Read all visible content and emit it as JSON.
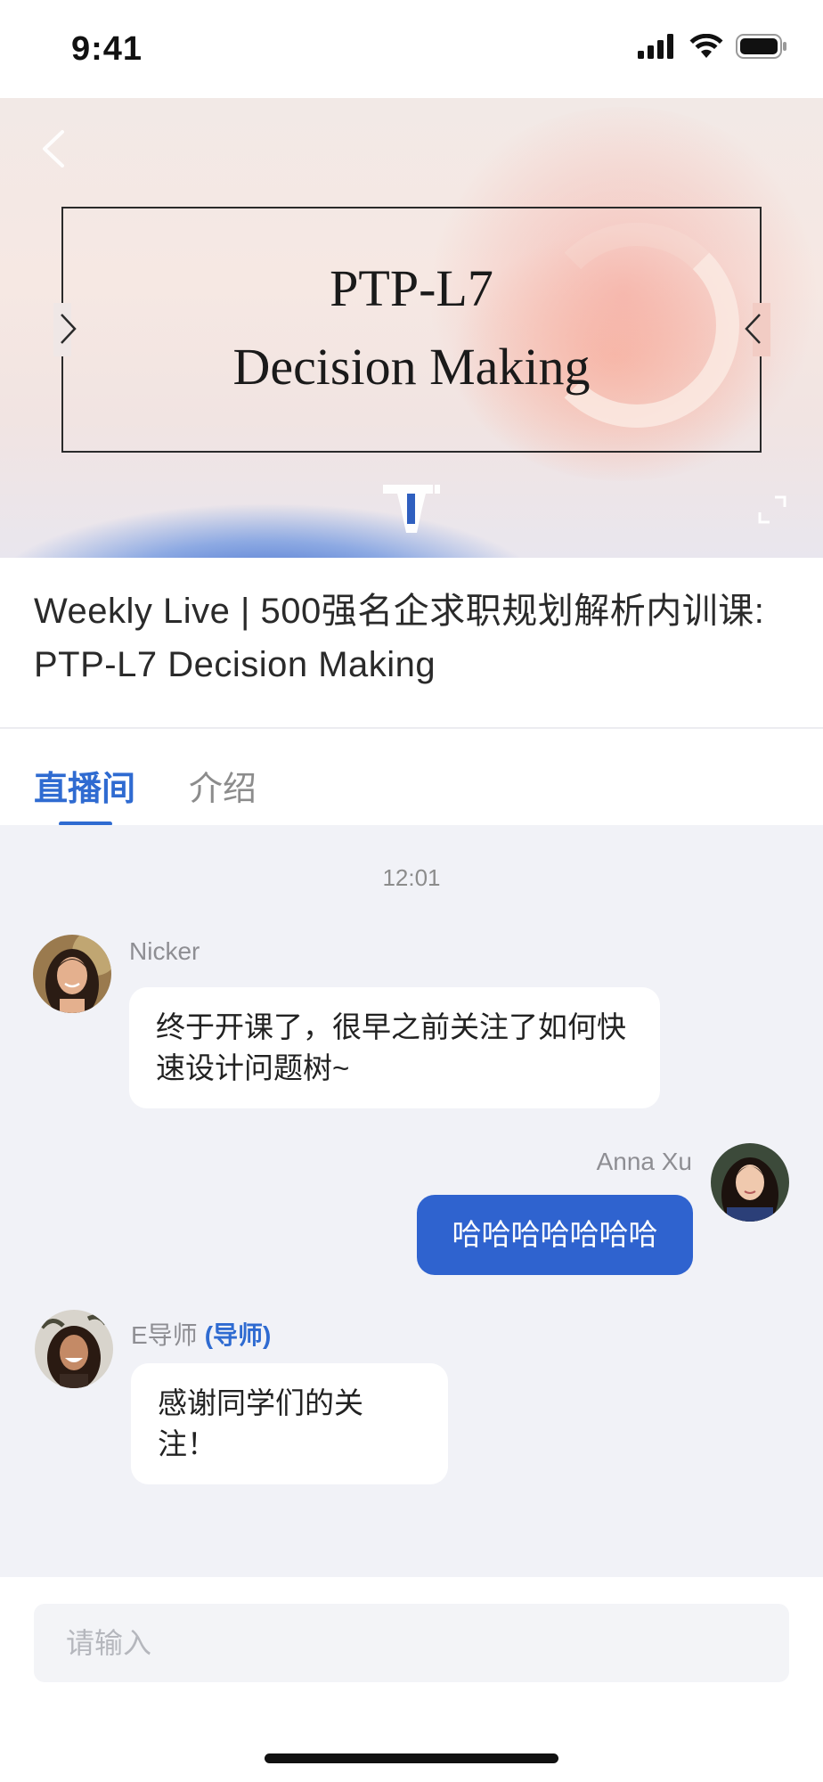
{
  "status_bar": {
    "time": "9:41"
  },
  "video": {
    "title_line1": "PTP-L7",
    "title_line2": "Decision Making"
  },
  "course": {
    "title": "Weekly Live | 500强名企求职规划解析内训课: PTP-L7 Decision Making"
  },
  "tabs": [
    {
      "label": "直播间",
      "active": true
    },
    {
      "label": "介绍",
      "active": false
    }
  ],
  "chat": {
    "timestamp": "12:01",
    "messages": [
      {
        "sender": "Nicker",
        "text": "终于开课了，很早之前关注了如何快速设计问题树~",
        "side": "left"
      },
      {
        "sender": "Anna Xu",
        "text": "哈哈哈哈哈哈哈",
        "side": "right"
      },
      {
        "sender": "E导师",
        "role": "(导师)",
        "text": "感谢同学们的关注！",
        "side": "left"
      }
    ]
  },
  "input": {
    "placeholder": "请输入"
  },
  "icons": {
    "back": "back-arrow-icon",
    "prev": "chevron-right-icon",
    "next": "chevron-left-icon",
    "fullscreen": "fullscreen-icon",
    "signal": "cellular-signal-icon",
    "wifi": "wifi-icon",
    "battery": "battery-icon"
  },
  "colors": {
    "accent": "#2f6bd1",
    "bubble_self": "#2f63cf",
    "chat_background": "#f1f2f7"
  }
}
